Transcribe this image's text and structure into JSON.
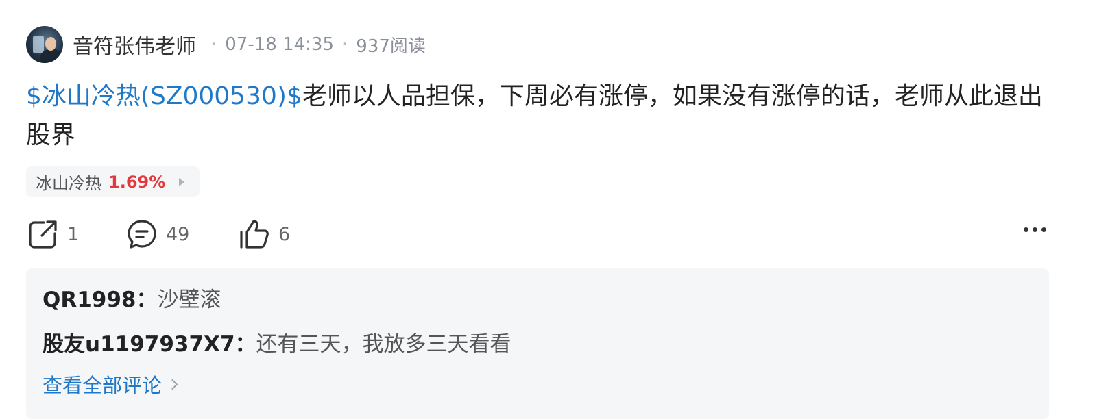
{
  "post": {
    "author": "音符张伟老师",
    "date": "07-18 14:35",
    "reads": "937阅读",
    "stock_tag": "$冰山冷热(SZ000530)$",
    "text": "老师以人品担保，下周必有涨停，如果没有涨停的话，老师从此退出股界"
  },
  "stock_chip": {
    "name": "冰山冷热",
    "change": "1.69%",
    "change_color": "#e4393c"
  },
  "actions": {
    "share_count": "1",
    "comment_count": "49",
    "like_count": "6",
    "icons": [
      "share-icon",
      "comment-icon",
      "like-icon",
      "more-icon"
    ]
  },
  "comments": {
    "items": [
      {
        "user": "QR1998：",
        "text": "沙壁滚"
      },
      {
        "user": "股友u1197937X7：",
        "text": "还有三天，我放多三天看看"
      }
    ],
    "view_all": "查看全部评论"
  },
  "colors": {
    "link": "#1f78c8",
    "gain": "#e4393c",
    "panel_bg": "#f5f6f8"
  }
}
